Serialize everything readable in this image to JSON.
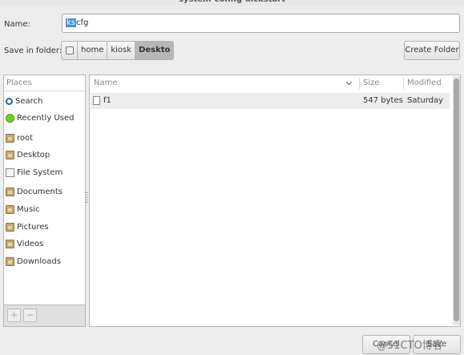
{
  "window": {
    "title": "system-config-kickstart"
  },
  "name_field": {
    "label": "Name:",
    "selected_part": "ks",
    "value_rest": "cfg"
  },
  "save_in": {
    "label": "Save in folder:",
    "path": [
      "home",
      "kiosk",
      "Deskto"
    ]
  },
  "toolbar": {
    "create_folder_label": "Create Folder"
  },
  "places": {
    "header": "Places",
    "items": [
      {
        "label": "Search",
        "icon": "search-icon"
      },
      {
        "label": "Recently Used",
        "icon": "recent-icon"
      },
      {
        "label": "root",
        "icon": "folder-icon"
      },
      {
        "label": "Desktop",
        "icon": "folder-icon"
      },
      {
        "label": "File System",
        "icon": "filesystem-icon"
      },
      {
        "label": "Documents",
        "icon": "folder-icon"
      },
      {
        "label": "Music",
        "icon": "folder-icon"
      },
      {
        "label": "Pictures",
        "icon": "folder-icon"
      },
      {
        "label": "Videos",
        "icon": "folder-icon"
      },
      {
        "label": "Downloads",
        "icon": "folder-icon"
      }
    ],
    "add_label": "+",
    "remove_label": "−"
  },
  "files": {
    "columns": {
      "name": "Name",
      "size": "Size",
      "modified": "Modified"
    },
    "rows": [
      {
        "name": "f1",
        "size": "547 bytes",
        "modified": "Saturday"
      }
    ]
  },
  "buttons": {
    "cancel_label": "Cancel",
    "save_label": "Save"
  },
  "watermark": "@51CTO博客"
}
